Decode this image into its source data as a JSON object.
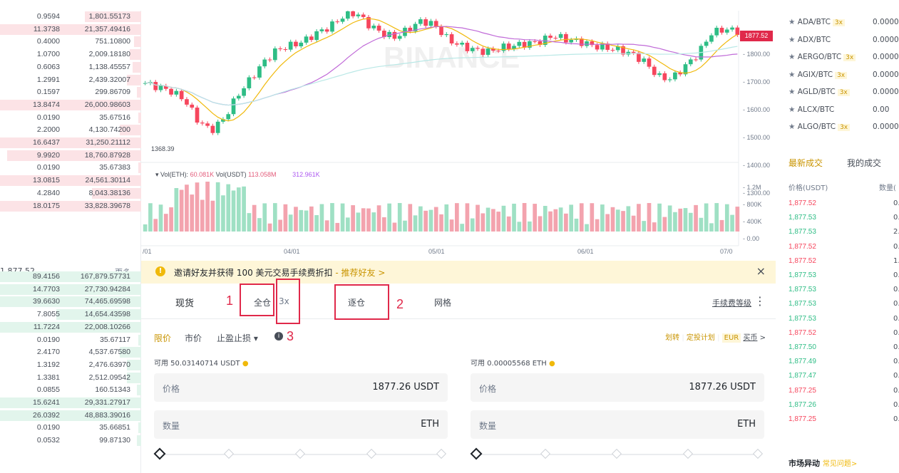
{
  "orderbook": {
    "asks": [
      {
        "q": "0.9594",
        "t": "1,801.55173",
        "w": 0.4
      },
      {
        "q": "11.3738",
        "t": "21,357.49416",
        "w": 1.0
      },
      {
        "q": "0.4000",
        "t": "751.10800",
        "w": 0.05
      },
      {
        "q": "1.0700",
        "t": "2,009.18180",
        "w": 0.08
      },
      {
        "q": "0.6063",
        "t": "1,138.45557",
        "w": 0.06
      },
      {
        "q": "1.2991",
        "t": "2,439.32007",
        "w": 0.1
      },
      {
        "q": "0.1597",
        "t": "299.86709",
        "w": 0.03
      },
      {
        "q": "13.8474",
        "t": "26,000.98603",
        "w": 1.0
      },
      {
        "q": "0.0190",
        "t": "35.67516",
        "w": 0.02
      },
      {
        "q": "2.2000",
        "t": "4,130.74200",
        "w": 0.15
      },
      {
        "q": "16.6437",
        "t": "31,250.21112",
        "w": 1.0
      },
      {
        "q": "9.9920",
        "t": "18,760.87928",
        "w": 0.95
      },
      {
        "q": "0.0190",
        "t": "35.67383",
        "w": 0.02
      },
      {
        "q": "13.0815",
        "t": "24,561.30114",
        "w": 1.0
      },
      {
        "q": "4.2840",
        "t": "8,043.38136",
        "w": 0.35
      },
      {
        "q": "18.0175",
        "t": "33,828.39678",
        "w": 1.0
      }
    ],
    "mid_price": "1,877.52",
    "more_label": "更多",
    "bids": [
      {
        "q": "89.4156",
        "t": "167,879.57731",
        "w": 1.0
      },
      {
        "q": "14.7703",
        "t": "27,730.94284",
        "w": 1.0
      },
      {
        "q": "39.6630",
        "t": "74,465.69598",
        "w": 1.0
      },
      {
        "q": "7.8055",
        "t": "14,654.43598",
        "w": 0.6
      },
      {
        "q": "11.7224",
        "t": "22,008.10266",
        "w": 1.0
      },
      {
        "q": "0.0190",
        "t": "35.67117",
        "w": 0.02
      },
      {
        "q": "2.4170",
        "t": "4,537.67580",
        "w": 0.15
      },
      {
        "q": "1.3192",
        "t": "2,476.63970",
        "w": 0.1
      },
      {
        "q": "1.3381",
        "t": "2,512.09542",
        "w": 0.1
      },
      {
        "q": "0.0855",
        "t": "160.51343",
        "w": 0.03
      },
      {
        "q": "15.6241",
        "t": "29,331.27917",
        "w": 1.0
      },
      {
        "q": "26.0392",
        "t": "48,883.39016",
        "w": 1.0
      },
      {
        "q": "0.0190",
        "t": "35.66851",
        "w": 0.02
      },
      {
        "q": "0.0532",
        "t": "99.87130",
        "w": 0.03
      }
    ]
  },
  "chart": {
    "price_tag": "1877.52",
    "low_label": "1368.39",
    "price_axis": [
      "1800.00",
      "1700.00",
      "1600.00",
      "1500.00",
      "1400.00",
      "1300.00"
    ],
    "vol_axis": [
      "1.2M",
      "800K",
      "400K",
      "0.00"
    ],
    "date_axis": [
      "/01",
      "04/01",
      "05/01",
      "06/01",
      "07/0"
    ],
    "vol_legend": {
      "a": "Vol(ETH):",
      "b": "60.081K",
      "c": "Vol(USDT)",
      "d": "113.058M",
      "e": "312.961K"
    },
    "watermark": "BINANCE"
  },
  "banner": {
    "text": "邀请好友并获得 100 美元交易手续费折扣",
    "link": "- 推荐好友 >",
    "close": "×"
  },
  "trade": {
    "tabs": {
      "spot": "现货",
      "cross": "全仓",
      "lev": "3x",
      "isolated": "逐仓",
      "grid": "网格"
    },
    "fee_level": "手续费等级",
    "more": "⋮",
    "annot": {
      "n1": "1",
      "n2": "2",
      "n3": "3"
    },
    "order_types": {
      "limit": "限价",
      "market": "市价",
      "stop": "止盈止损 ▾"
    },
    "right_links": {
      "a": "划转",
      "b": "定投计划",
      "c": "EUR",
      "d": "买币",
      "e": ">"
    },
    "buy": {
      "avail": "可用  50.03140714 USDT",
      "price_label": "价格",
      "price": "1877.26  USDT",
      "qty_label": "数量",
      "qty_unit": "ETH"
    },
    "sell": {
      "avail": "可用  0.00005568 ETH",
      "price_label": "价格",
      "price": "1877.26  USDT",
      "qty_label": "数量",
      "qty_unit": "ETH"
    }
  },
  "market": {
    "pairs": [
      {
        "name": "ADA/BTC",
        "lev": "3x",
        "val": "0.0000"
      },
      {
        "name": "ADX/BTC",
        "lev": "",
        "val": "0.0000"
      },
      {
        "name": "AERGO/BTC",
        "lev": "3x",
        "val": "0.0000"
      },
      {
        "name": "AGIX/BTC",
        "lev": "3x",
        "val": "0.0000"
      },
      {
        "name": "AGLD/BTC",
        "lev": "3x",
        "val": "0.0000"
      },
      {
        "name": "ALCX/BTC",
        "lev": "",
        "val": "0.00"
      },
      {
        "name": "ALGO/BTC",
        "lev": "3x",
        "val": "0.0000"
      }
    ],
    "tab_latest": "最新成交",
    "tab_mine": "我的成交",
    "hdr_price": "价格(USDT)",
    "hdr_qty": "数量(",
    "trades": [
      {
        "p": "1,877.52",
        "side": "sell",
        "q": "0."
      },
      {
        "p": "1,877.53",
        "side": "buy",
        "q": "0."
      },
      {
        "p": "1,877.53",
        "side": "buy",
        "q": "2."
      },
      {
        "p": "1,877.52",
        "side": "sell",
        "q": "0."
      },
      {
        "p": "1,877.52",
        "side": "sell",
        "q": "1."
      },
      {
        "p": "1,877.53",
        "side": "buy",
        "q": "0."
      },
      {
        "p": "1,877.53",
        "side": "buy",
        "q": "0."
      },
      {
        "p": "1,877.53",
        "side": "buy",
        "q": "0."
      },
      {
        "p": "1,877.53",
        "side": "buy",
        "q": "0."
      },
      {
        "p": "1,877.52",
        "side": "sell",
        "q": "0."
      },
      {
        "p": "1,877.50",
        "side": "buy",
        "q": "0."
      },
      {
        "p": "1,877.49",
        "side": "buy",
        "q": "0."
      },
      {
        "p": "1,877.47",
        "side": "buy",
        "q": "0."
      },
      {
        "p": "1,877.25",
        "side": "sell",
        "q": "0."
      },
      {
        "p": "1,877.26",
        "side": "buy",
        "q": "0."
      },
      {
        "p": "1,877.25",
        "side": "sell",
        "q": "0."
      }
    ],
    "bottom_title": "市场异动",
    "bottom_link": "常见问题>"
  },
  "colors": {
    "up": "#2ebd85",
    "down": "#f6465d",
    "accent": "#f0b90b",
    "annot": "#e0294a"
  }
}
